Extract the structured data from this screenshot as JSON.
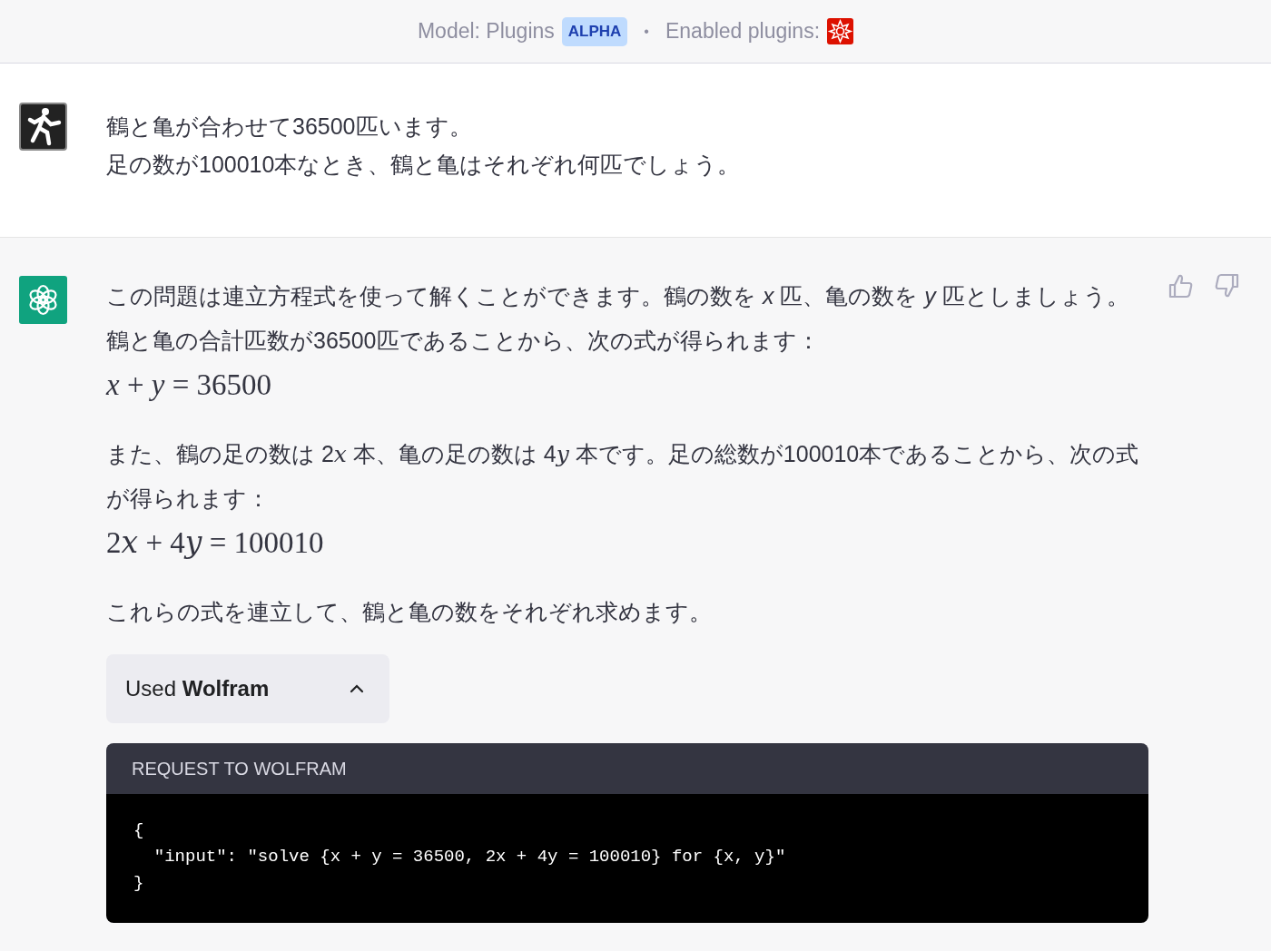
{
  "header": {
    "model_label": "Model: Plugins",
    "badge": "ALPHA",
    "separator": "•",
    "plugins_label": "Enabled plugins:"
  },
  "user_message": {
    "lines": [
      "鶴と亀が合わせて36500匹います。",
      "足の数が100010本なとき、鶴と亀はそれぞれ何匹でしょう。"
    ]
  },
  "assistant_message": {
    "blocks": [
      {
        "kind": "paragraph",
        "text": "この問題は連立方程式を使って解くことができます。鶴の数を *x* 匹、亀の数を *y* 匹としましょう。鶴と亀の合計匹数が36500匹であることから、次の式が得られます："
      },
      {
        "kind": "equation",
        "text": "*x* + *y* = 36500"
      },
      {
        "kind": "paragraph",
        "parts": [
          {
            "kind": "text",
            "text": "また、鶴の足の数は 2"
          },
          {
            "kind": "var",
            "text": "x"
          },
          {
            "kind": "text",
            "text": " 本、亀の足の数は 4"
          },
          {
            "kind": "var",
            "text": "y"
          },
          {
            "kind": "text",
            "text": " 本です。足の総数が100010本であることから、次の式が得られます："
          }
        ]
      },
      {
        "kind": "equation",
        "parts": [
          {
            "kind": "text",
            "text": "2"
          },
          {
            "kind": "var",
            "text": "x"
          },
          {
            "kind": "text",
            "text": " + 4"
          },
          {
            "kind": "var",
            "text": "y"
          },
          {
            "kind": "text",
            "text": " = 100010"
          }
        ]
      },
      {
        "kind": "paragraph",
        "text": "これらの式を連立して、鶴と亀の数をそれぞれ求めます。"
      }
    ],
    "tool": {
      "label": "Used **Wolfram**",
      "expanded": true
    },
    "request": {
      "title": "REQUEST TO WOLFRAM",
      "lines": [
        "{",
        "  \"input\": \"solve {x + y = 36500, 2x + 4y = 100010} for {x, y}\"",
        "}"
      ]
    }
  }
}
